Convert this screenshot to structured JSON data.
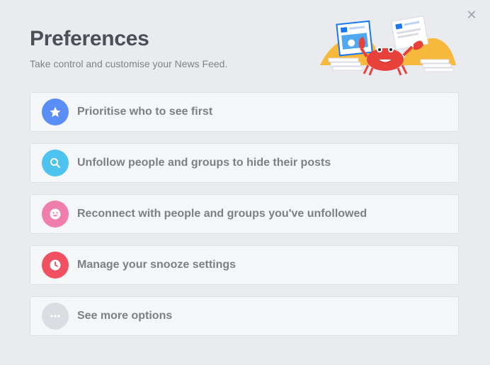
{
  "dialog": {
    "title": "Preferences",
    "subtitle": "Take control and customise your News Feed.",
    "close_icon": "close-icon"
  },
  "options": [
    {
      "label": "Prioritise who to see first",
      "icon": "star-icon",
      "color": "#5b8ef5"
    },
    {
      "label": "Unfollow people and groups to hide their posts",
      "icon": "search-icon",
      "color": "#4fc3f0"
    },
    {
      "label": "Reconnect with people and groups you've unfollowed",
      "icon": "smile-icon",
      "color": "#f07eac"
    },
    {
      "label": "Manage your snooze settings",
      "icon": "clock-icon",
      "color": "#f05060"
    },
    {
      "label": "See more options",
      "icon": "more-icon",
      "color": "#dadde1"
    }
  ],
  "illustration": "crab-holding-posts-illustration"
}
